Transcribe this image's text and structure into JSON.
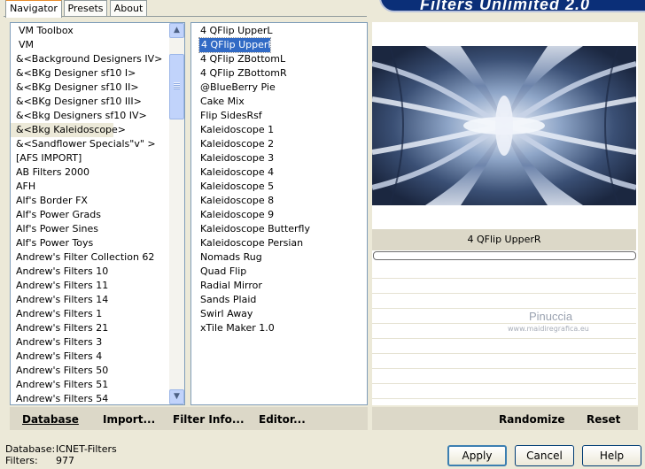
{
  "app": {
    "title": "Filters Unlimited 2.0"
  },
  "tabs": [
    {
      "label": "Navigator",
      "active": true
    },
    {
      "label": "Presets",
      "active": false
    },
    {
      "label": "About",
      "active": false
    }
  ],
  "categories": {
    "items": [
      "VM Toolbox",
      "VM",
      "&<Background Designers IV>",
      "&<BKg Designer sf10 I>",
      "&<BKg Designer sf10 II>",
      "&<BKg Designer sf10 III>",
      "&<Bkg Designers sf10 IV>",
      "&<Bkg Kaleidoscope>",
      "&<Sandflower Specials\"v\" >",
      "[AFS IMPORT]",
      "AB Filters 2000",
      "AFH",
      "Alf's Border FX",
      "Alf's Power Grads",
      "Alf's Power Sines",
      "Alf's Power Toys",
      "Andrew's Filter Collection 62",
      "Andrew's Filters 10",
      "Andrew's Filters 11",
      "Andrew's Filters 14",
      "Andrew's Filters 1",
      "Andrew's Filters 21",
      "Andrew's Filters 3",
      "Andrew's Filters 4",
      "Andrew's Filters 50",
      "Andrew's Filters 51",
      "Andrew's Filters 54"
    ],
    "selected": "&<Bkg Kaleidoscope>"
  },
  "filters": {
    "items": [
      "4 QFlip UpperL",
      "4 QFlip UpperR",
      "4 QFlip ZBottomL",
      "4 QFlip ZBottomR",
      "@BlueBerry Pie",
      "Cake Mix",
      "Flip SidesRsf",
      "Kaleidoscope 1",
      "Kaleidoscope 2",
      "Kaleidoscope 3",
      "Kaleidoscope 4",
      "Kaleidoscope 5",
      "Kaleidoscope 8",
      "Kaleidoscope 9",
      "Kaleidoscope Butterfly",
      "Kaleidoscope Persian",
      "Nomads Rug",
      "Quad Flip",
      "Radial Mirror",
      "Sands Plaid",
      "Swirl Away",
      "xTile Maker 1.0"
    ],
    "selected": "4 QFlip UpperR"
  },
  "preview": {
    "filter_name": "4 QFlip UpperR",
    "progress": 0,
    "watermark_name": "Pinuccia",
    "watermark_url": "www.maidiregrafica.eu"
  },
  "toolbar": {
    "database_label": "Database",
    "import_label": "Import...",
    "filter_info_label": "Filter Info...",
    "editor_label": "Editor...",
    "randomize_label": "Randomize",
    "reset_label": "Reset"
  },
  "status": {
    "database_label": "Database:",
    "database_value": "ICNET-Filters",
    "filters_label": "Filters:",
    "filters_value": "977"
  },
  "buttons": {
    "apply": "Apply",
    "cancel": "Cancel",
    "help": "Help"
  },
  "colors": {
    "selection_blue": "#316ac5",
    "banner_blue": "#0b2f78",
    "window_bg": "#ece9d8"
  }
}
